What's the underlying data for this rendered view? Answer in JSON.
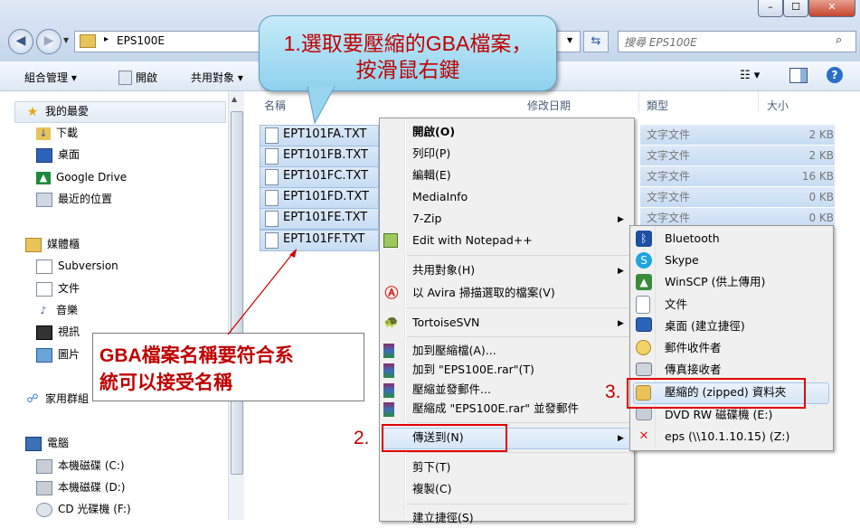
{
  "window": {
    "minimize_glyph": "–",
    "maximize_glyph": "☐",
    "close_glyph": "✕"
  },
  "address": {
    "path": "EPS100E",
    "separator": "▸",
    "search_placeholder": "搜尋 EPS100E"
  },
  "toolbar": {
    "organize": "組合管理 ▾",
    "open": "開啟",
    "share": "共用對象 ▾"
  },
  "sidebar": {
    "favorites_header": "我的最愛",
    "favorites": [
      "下載",
      "桌面",
      "Google Drive",
      "最近的位置"
    ],
    "libraries_header": "媒體櫃",
    "libraries": [
      "Subversion",
      "文件",
      "音樂",
      "視訊",
      "圖片"
    ],
    "homegroup": "家用群組",
    "computer_header": "電腦",
    "drives": [
      "本機磁碟 (C:)",
      "本機磁碟 (D:)",
      "CD 光碟機 (F:)"
    ]
  },
  "columns": {
    "name": "名稱",
    "modified": "修改日期",
    "type": "類型",
    "size": "大小"
  },
  "files": [
    {
      "name": "EPT101FA.TXT",
      "type": "文字文件",
      "size": "2 KB"
    },
    {
      "name": "EPT101FB.TXT",
      "type": "文字文件",
      "size": "2 KB"
    },
    {
      "name": "EPT101FC.TXT",
      "type": "文字文件",
      "size": "16 KB"
    },
    {
      "name": "EPT101FD.TXT",
      "type": "文字文件",
      "size": "0 KB"
    },
    {
      "name": "EPT101FE.TXT",
      "type": "文字文件",
      "size": "0 KB"
    },
    {
      "name": "EPT101FF.TXT"
    }
  ],
  "context_menu": {
    "open": "開啟(O)",
    "print": "列印(P)",
    "edit": "編輯(E)",
    "mediainfo": "MediaInfo",
    "sevenzip": "7-Zip",
    "notepadpp": "Edit with Notepad++",
    "share": "共用對象(H)",
    "avira": "以 Avira 掃描選取的檔案(V)",
    "tortoise": "TortoiseSVN",
    "add_archive": "加到壓縮檔(A)...",
    "add_rar": "加到 \"EPS100E.rar\"(T)",
    "compress_email": "壓縮並發郵件...",
    "compress_rar_email": "壓縮成 \"EPS100E.rar\" 並發郵件",
    "send_to": "傳送到(N)",
    "cut": "剪下(T)",
    "copy": "複製(C)",
    "shortcut": "建立捷徑(S)"
  },
  "send_to_menu": [
    "Bluetooth",
    "Skype",
    "WinSCP (供上傳用)",
    "文件",
    "桌面 (建立捷徑)",
    "郵件收件者",
    "傳真接收者",
    "壓縮的 (zipped) 資料夾",
    "DVD RW 磁碟機 (E:)",
    "eps (\\\\10.1.10.15) (Z:)"
  ],
  "annotations": {
    "bubble_line1": "1.選取要壓縮的GBA檔案，",
    "bubble_line2": "按滑鼠右鍵",
    "note_line1": "GBA檔案名稱要符合系",
    "note_line2": "統可以接受名稱",
    "step2": "2.",
    "step3": "3.",
    "accent_color": "#c00000"
  }
}
